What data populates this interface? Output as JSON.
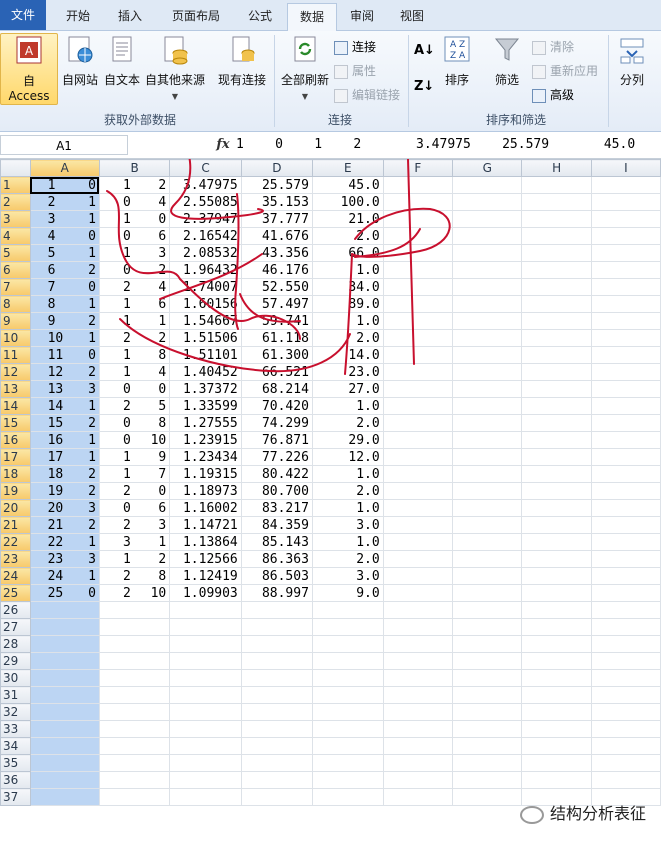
{
  "tabs": [
    "文件",
    "开始",
    "插入",
    "页面布局",
    "公式",
    "数据",
    "审阅",
    "视图"
  ],
  "ribbon": {
    "external": {
      "access": "自 Access",
      "web": "自网站",
      "text": "自文本",
      "other": "自其他来源",
      "existing": "现有连接",
      "group": "获取外部数据"
    },
    "connections": {
      "refresh": "全部刷新",
      "connect": "连接",
      "properties": "属性",
      "edit_links": "编辑链接",
      "group": "连接"
    },
    "sortfilter": {
      "sort": "排序",
      "filter": "筛选",
      "clear": "清除",
      "reapply": "重新应用",
      "advanced": "高级",
      "group": "排序和筛选"
    },
    "tools": {
      "split": "分列"
    }
  },
  "formula": {
    "namebox": "A1",
    "fx": "fx",
    "content": "1    0    1    2       3.47975    25.579       45.0"
  },
  "columns": [
    "A",
    "B",
    "C",
    "D",
    "E",
    "F",
    "G",
    "H",
    "I"
  ],
  "rows": [
    [
      "1",
      "0",
      "1",
      "2",
      "3.47975",
      "25.579",
      "45.0"
    ],
    [
      "2",
      "1",
      "0",
      "4",
      "2.55085",
      "35.153",
      "100.0"
    ],
    [
      "3",
      "1",
      "1",
      "0",
      "2.37947",
      "37.777",
      "21.0"
    ],
    [
      "4",
      "0",
      "0",
      "6",
      "2.16542",
      "41.676",
      "2.0"
    ],
    [
      "5",
      "1",
      "1",
      "3",
      "2.08532",
      "43.356",
      "66.0"
    ],
    [
      "6",
      "2",
      "0",
      "2",
      "1.96432",
      "46.176",
      "1.0"
    ],
    [
      "7",
      "0",
      "2",
      "4",
      "1.74007",
      "52.550",
      "34.0"
    ],
    [
      "8",
      "1",
      "1",
      "6",
      "1.60156",
      "57.497",
      "89.0"
    ],
    [
      "9",
      "2",
      "1",
      "1",
      "1.54667",
      "59.741",
      "1.0"
    ],
    [
      "10",
      "1",
      "2",
      "2",
      "1.51506",
      "61.118",
      "2.0"
    ],
    [
      "11",
      "0",
      "1",
      "8",
      "1.51101",
      "61.300",
      "14.0"
    ],
    [
      "12",
      "2",
      "1",
      "4",
      "1.40452",
      "66.521",
      "23.0"
    ],
    [
      "13",
      "3",
      "0",
      "0",
      "1.37372",
      "68.214",
      "27.0"
    ],
    [
      "14",
      "1",
      "2",
      "5",
      "1.33599",
      "70.420",
      "1.0"
    ],
    [
      "15",
      "2",
      "0",
      "8",
      "1.27555",
      "74.299",
      "2.0"
    ],
    [
      "16",
      "1",
      "0",
      "10",
      "1.23915",
      "76.871",
      "29.0"
    ],
    [
      "17",
      "1",
      "1",
      "9",
      "1.23434",
      "77.226",
      "12.0"
    ],
    [
      "18",
      "2",
      "1",
      "7",
      "1.19315",
      "80.422",
      "1.0"
    ],
    [
      "19",
      "2",
      "2",
      "0",
      "1.18973",
      "80.700",
      "2.0"
    ],
    [
      "20",
      "3",
      "0",
      "6",
      "1.16002",
      "83.217",
      "1.0"
    ],
    [
      "21",
      "2",
      "2",
      "3",
      "1.14721",
      "84.359",
      "3.0"
    ],
    [
      "22",
      "1",
      "3",
      "1",
      "1.13864",
      "85.143",
      "1.0"
    ],
    [
      "23",
      "3",
      "1",
      "2",
      "1.12566",
      "86.363",
      "2.0"
    ],
    [
      "24",
      "1",
      "2",
      "8",
      "1.12419",
      "86.503",
      "3.0"
    ],
    [
      "25",
      "0",
      "2",
      "10",
      "1.09903",
      "88.997",
      "9.0"
    ]
  ],
  "row_numbers": [
    "1",
    "2",
    "3",
    "4",
    "5",
    "6",
    "7",
    "8",
    "9",
    "10",
    "11",
    "12",
    "13",
    "14",
    "15",
    "16",
    "17",
    "18",
    "19",
    "20",
    "21",
    "22",
    "23",
    "24",
    "25",
    "26",
    "27",
    "28",
    "29",
    "30",
    "31",
    "32",
    "33",
    "34",
    "35",
    "36",
    "37"
  ],
  "watermark": "结构分析表征",
  "colors": {
    "file_tab": "#2a63b5",
    "selection": "#bcd5f3",
    "ink": "#c8102e"
  }
}
